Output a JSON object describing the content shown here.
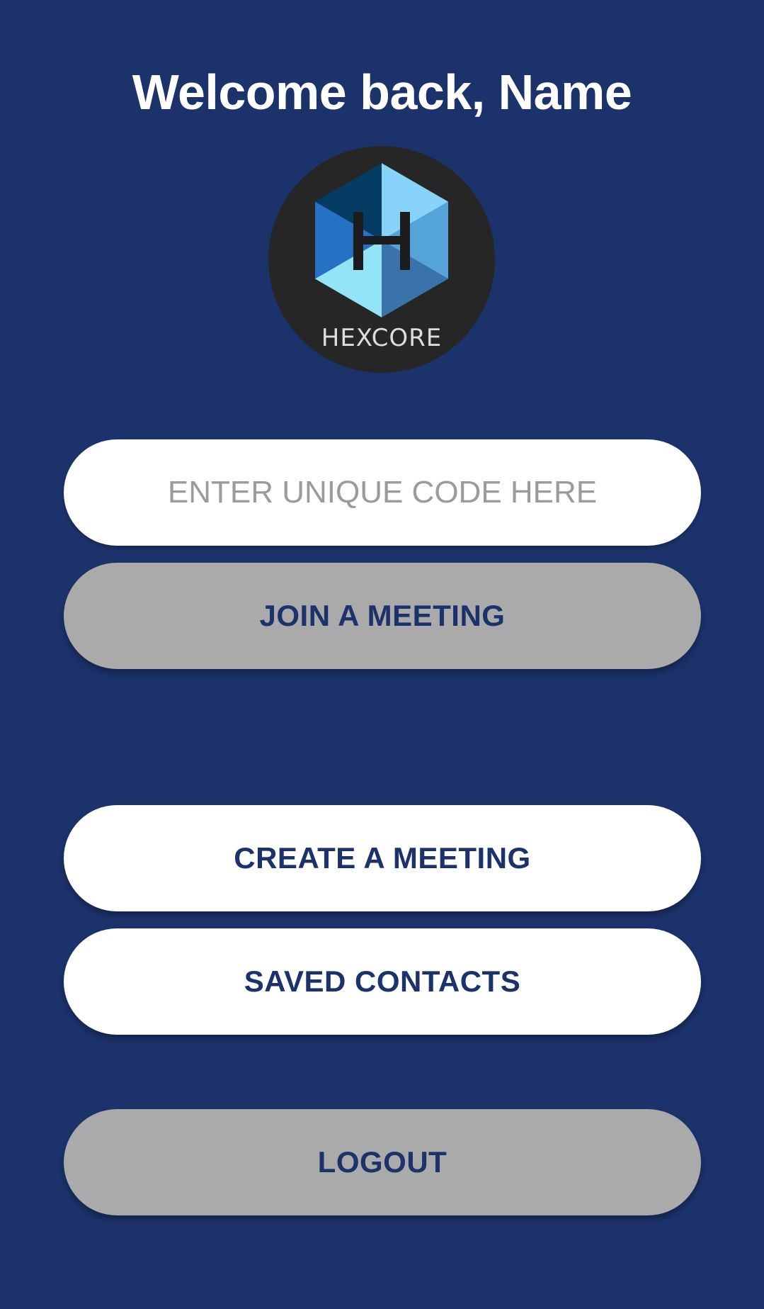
{
  "header": {
    "welcome_text": "Welcome back, Name"
  },
  "logo": {
    "brand_text": "HEXCORE",
    "colors": {
      "background": "#262626",
      "top_left": "#053c63",
      "top_right": "#87d3fa",
      "left": "#2771c5",
      "right": "#55a4d9",
      "bottom_left": "#93e4f6",
      "bottom_right": "#3a72aa",
      "letter": "#1c1c1c",
      "text": "#dcdcdc"
    }
  },
  "code_input": {
    "placeholder": "ENTER UNIQUE CODE HERE",
    "value": ""
  },
  "buttons": {
    "join_label": "JOIN A MEETING",
    "create_label": "CREATE A MEETING",
    "saved_contacts_label": "SAVED CONTACTS",
    "logout_label": "LOGOUT"
  },
  "colors": {
    "background": "#1c326b",
    "button_text": "#1c326b",
    "primary_button": "#ffffff",
    "secondary_button": "#aaaaaa"
  }
}
